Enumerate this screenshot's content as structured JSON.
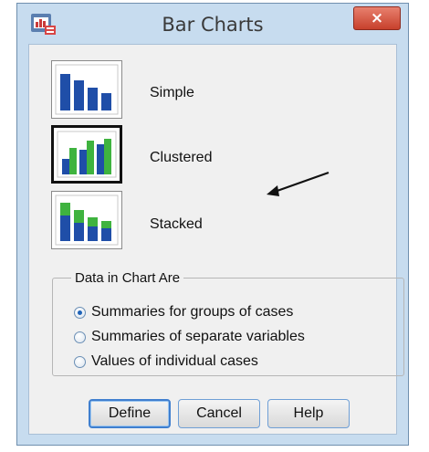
{
  "window": {
    "title": "Bar Charts",
    "close_symbol": "×"
  },
  "chart_types": [
    {
      "label": "Simple",
      "icon": "simple-bar-chart-icon",
      "selected": false
    },
    {
      "label": "Clustered",
      "icon": "clustered-bar-chart-icon",
      "selected": true
    },
    {
      "label": "Stacked",
      "icon": "stacked-bar-chart-icon",
      "selected": false
    }
  ],
  "data_group": {
    "legend": "Data in Chart Are",
    "options": [
      {
        "label": "Summaries for groups of cases",
        "checked": true
      },
      {
        "label": "Summaries of separate variables",
        "checked": false
      },
      {
        "label": "Values of individual cases",
        "checked": false
      }
    ]
  },
  "buttons": {
    "define": "Define",
    "cancel": "Cancel",
    "help": "Help"
  },
  "colors": {
    "bar_blue": "#1f4ea8",
    "bar_green": "#3fb33f",
    "close_red": "#c7402c",
    "dialog_frame": "#c7dcef"
  }
}
